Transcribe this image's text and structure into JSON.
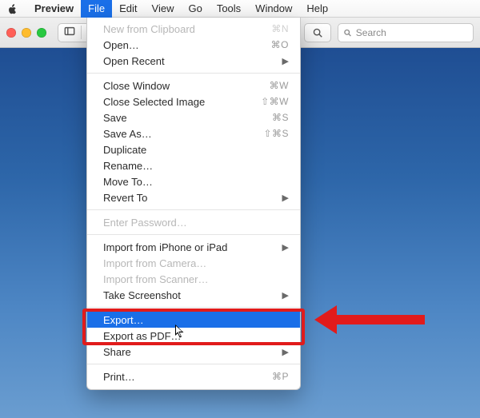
{
  "menubar": {
    "app": "Preview",
    "items": [
      "File",
      "Edit",
      "View",
      "Go",
      "Tools",
      "Window",
      "Help"
    ],
    "open_index": 0
  },
  "toolbar": {
    "search_placeholder": "Search"
  },
  "dropdown": {
    "groups": [
      [
        {
          "label": "New from Clipboard",
          "shortcut": "⌘N",
          "disabled": true
        },
        {
          "label": "Open…",
          "shortcut": "⌘O"
        },
        {
          "label": "Open Recent",
          "submenu": true
        }
      ],
      [
        {
          "label": "Close Window",
          "shortcut": "⌘W"
        },
        {
          "label": "Close Selected Image",
          "shortcut": "⇧⌘W"
        },
        {
          "label": "Save",
          "shortcut": "⌘S"
        },
        {
          "label": "Save As…",
          "shortcut": "⇧⌘S"
        },
        {
          "label": "Duplicate"
        },
        {
          "label": "Rename…"
        },
        {
          "label": "Move To…"
        },
        {
          "label": "Revert To",
          "submenu": true
        }
      ],
      [
        {
          "label": "Enter Password…",
          "disabled": true
        }
      ],
      [
        {
          "label": "Import from iPhone or iPad",
          "submenu": true
        },
        {
          "label": "Import from Camera…",
          "disabled": true
        },
        {
          "label": "Import from Scanner…",
          "disabled": true
        },
        {
          "label": "Take Screenshot",
          "submenu": true
        }
      ],
      [
        {
          "label": "Export…",
          "highlight": true
        },
        {
          "label": "Export as PDF…"
        },
        {
          "label": "Share",
          "submenu": true
        }
      ],
      [
        {
          "label": "Print…",
          "shortcut": "⌘P"
        }
      ]
    ]
  },
  "annotation": {
    "target_label": "Export…"
  }
}
